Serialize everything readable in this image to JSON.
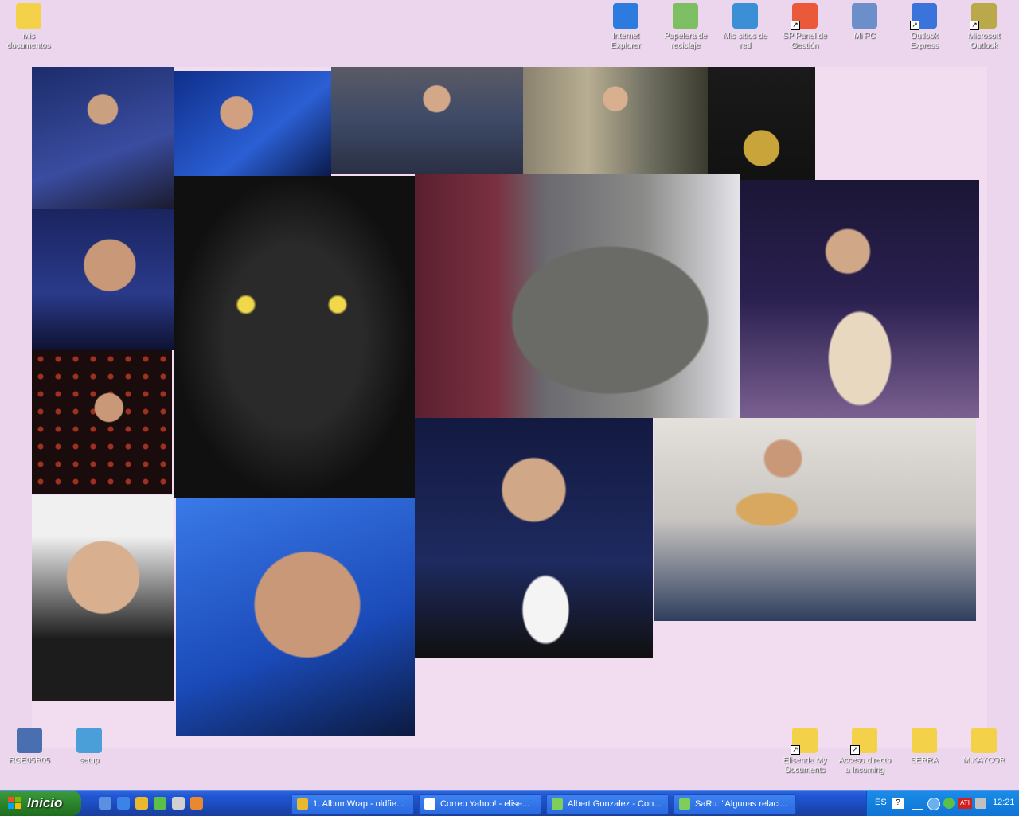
{
  "desktop": {
    "background_color": "#ecd6ee",
    "icons_top_left": [
      {
        "name": "mis-documentos-icon",
        "label_lines": [
          "Mis",
          "documentos"
        ],
        "color": "#f3d24a"
      }
    ],
    "icons_top_right": [
      {
        "name": "internet-explorer-icon",
        "label_lines": [
          "Internet",
          "Explorer"
        ],
        "color": "#2e7be0"
      },
      {
        "name": "papelera-icon",
        "label_lines": [
          "Papelera de",
          "reciclaje"
        ],
        "color": "#7dbf62"
      },
      {
        "name": "mis-sitios-de-red-icon",
        "label_lines": [
          "Mis sitios de",
          "red"
        ],
        "color": "#3b8fd6"
      },
      {
        "name": "sp-panel-icon",
        "label_lines": [
          "SP Panel de",
          "Gestión"
        ],
        "color": "#e9593a"
      },
      {
        "name": "mi-pc-icon",
        "label_lines": [
          "Mi PC"
        ],
        "color": "#6d8fc9"
      },
      {
        "name": "outlook-express-icon",
        "label_lines": [
          "Outlook",
          "Express"
        ],
        "color": "#3a73d9"
      },
      {
        "name": "microsoft-outlook-icon",
        "label_lines": [
          "Microsoft",
          "Outlook"
        ],
        "color": "#b9a94a"
      }
    ],
    "icons_bottom_left": [
      {
        "name": "rge05r05-icon",
        "label_lines": [
          "RGE05R05"
        ],
        "color": "#4a6fb0"
      },
      {
        "name": "setup-icon",
        "label_lines": [
          "setup"
        ],
        "color": "#4a9fd8"
      }
    ],
    "icons_bottom_right": [
      {
        "name": "elisenda-my-documents-icon",
        "label_lines": [
          "Elisenda My",
          "Documents"
        ],
        "color": "#f3d24a"
      },
      {
        "name": "acceso-directo-incoming-icon",
        "label_lines": [
          "Acceso directo",
          "a Incoming"
        ],
        "color": "#f3d24a"
      },
      {
        "name": "serra-folder-icon",
        "label_lines": [
          "SERRA"
        ],
        "color": "#f3d24a"
      },
      {
        "name": "mikaycor-folder-icon",
        "label_lines": [
          "M.KAYCOR"
        ],
        "color": "#f3d24a"
      }
    ]
  },
  "taskbar": {
    "start_label": "Inicio",
    "quick_launch": [
      {
        "name": "quicklaunch-desktop-icon",
        "color": "#5b8fe0"
      },
      {
        "name": "quicklaunch-ie-icon",
        "color": "#3b83e8"
      },
      {
        "name": "quicklaunch-albumwrap-icon",
        "color": "#e8b830"
      },
      {
        "name": "quicklaunch-messenger-icon",
        "color": "#5cbf48"
      },
      {
        "name": "quicklaunch-media-icon",
        "color": "#d0d0d0"
      },
      {
        "name": "quicklaunch-winamp-icon",
        "color": "#e88830"
      }
    ],
    "tasks": [
      {
        "label": "1. AlbumWrap - oldfie...",
        "icon_color": "#e8b830",
        "name": "task-albumwrap"
      },
      {
        "label": "Correo Yahoo! - elise...",
        "icon_color": "#ffffff",
        "name": "task-correo-yahoo"
      },
      {
        "label": "Albert Gonzalez - Con...",
        "icon_color": "#7ecf5a",
        "name": "task-albert-gonzalez"
      },
      {
        "label": "SaRu: \"Algunas relaci...",
        "icon_color": "#7ecf5a",
        "name": "task-saru"
      }
    ],
    "tray": {
      "language": "ES",
      "clock": "12:21"
    }
  },
  "colors": {
    "taskbar_blue": "#2157d7",
    "start_green": "#2f8a2f",
    "tray_blue": "#1a8de8"
  }
}
